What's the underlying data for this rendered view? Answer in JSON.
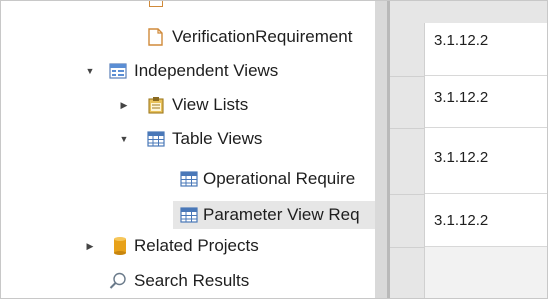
{
  "tree": {
    "items": [
      {
        "label": "VerificationRequirement",
        "icon": "page-orange-icon"
      },
      {
        "label": "Independent Views",
        "icon": "views-icon",
        "expanded": true
      },
      {
        "label": "View Lists",
        "icon": "clipboard-icon",
        "expanded": false
      },
      {
        "label": "Table Views",
        "icon": "table-icon",
        "expanded": true
      },
      {
        "label": "Operational Require",
        "icon": "table-icon"
      },
      {
        "label": "Parameter View Req",
        "icon": "table-icon",
        "selected": true
      },
      {
        "label": "Related Projects",
        "icon": "cylinder-icon",
        "expanded": false
      },
      {
        "label": "Search Results",
        "icon": "search-icon"
      }
    ]
  },
  "grid": {
    "cells": [
      "3.1.12.2",
      "3.1.12.2",
      "3.1.12.2",
      "3.1.12.2"
    ]
  }
}
